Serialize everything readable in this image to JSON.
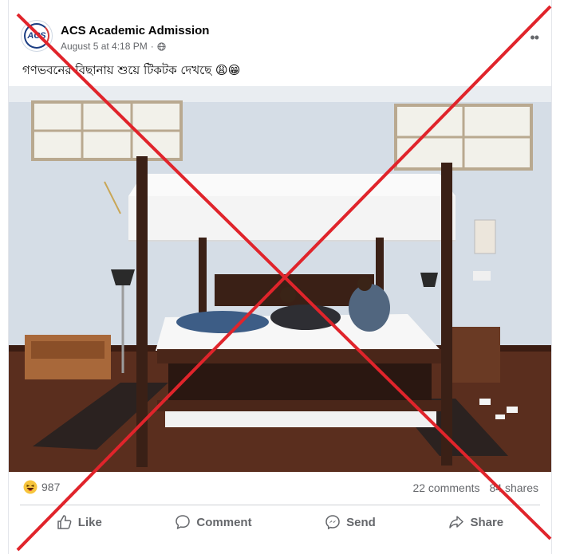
{
  "post": {
    "page_name": "ACS Academic Admission",
    "avatar_text": "ACS",
    "date": "August 5 at 4:18 PM",
    "separator": "·",
    "caption": "গণভবনের বিছানায় শুয়ে টিকটক দেখছে 😩😁",
    "more_label": "••"
  },
  "stats": {
    "reaction_emoji": "haha-icon",
    "reaction_count": "987",
    "comments": "22 comments",
    "shares": "84 shares"
  },
  "actions": {
    "like": "Like",
    "comment": "Comment",
    "send": "Send",
    "share": "Share"
  },
  "colors": {
    "cross": "#e0242b",
    "text_secondary": "#65676b",
    "text_primary": "#050505"
  }
}
